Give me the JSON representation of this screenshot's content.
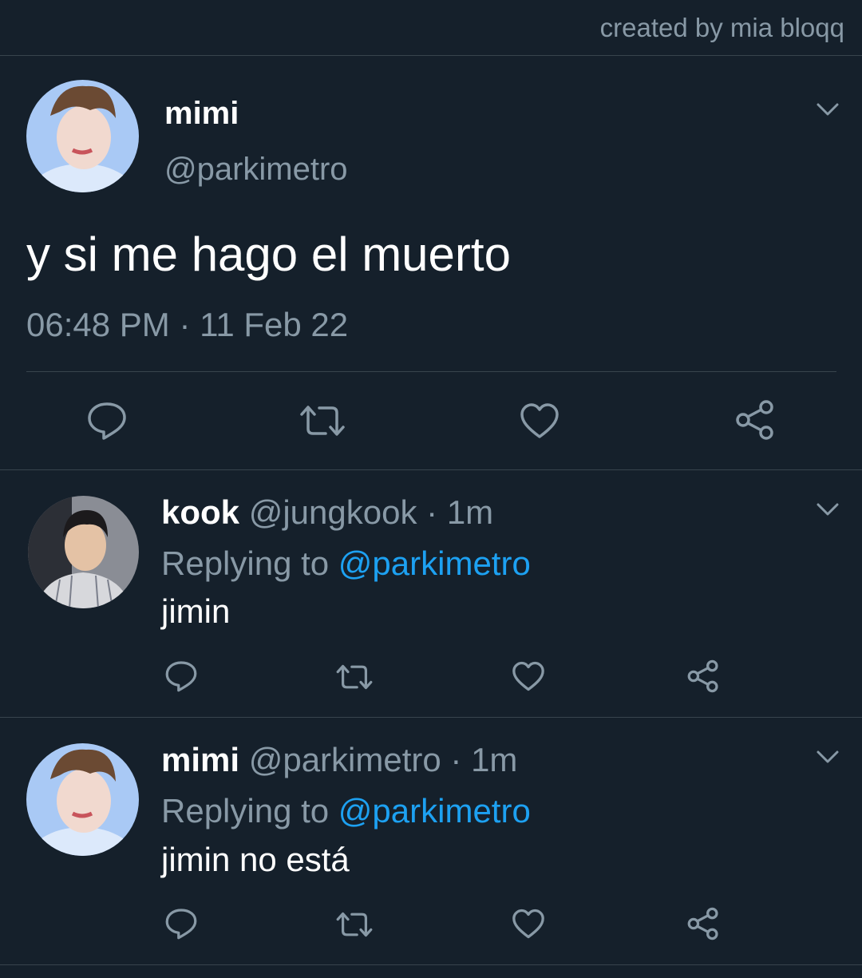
{
  "credit": "created by mia bloqq",
  "main_tweet": {
    "name": "mimi",
    "handle": "@parkimetro",
    "text": "y si me hago el muerto",
    "time": "06:48 PM",
    "date": "11 Feb 22",
    "separator": "·"
  },
  "replies": [
    {
      "name": "kook",
      "handle": "@jungkook",
      "age": "1m",
      "separator": "·",
      "replying_prefix": "Replying to",
      "replying_to": "@parkimetro",
      "text": "jimin"
    },
    {
      "name": "mimi",
      "handle": "@parkimetro",
      "age": "1m",
      "separator": "·",
      "replying_prefix": "Replying to",
      "replying_to": "@parkimetro",
      "text": "jimin no está"
    }
  ],
  "icons": [
    "comment-icon",
    "retweet-icon",
    "like-icon",
    "share-icon",
    "chevron-down-icon"
  ],
  "colors": {
    "background": "#15202b",
    "secondary_text": "#8899a6",
    "mention": "#1da1f2",
    "divider": "#38444d"
  }
}
